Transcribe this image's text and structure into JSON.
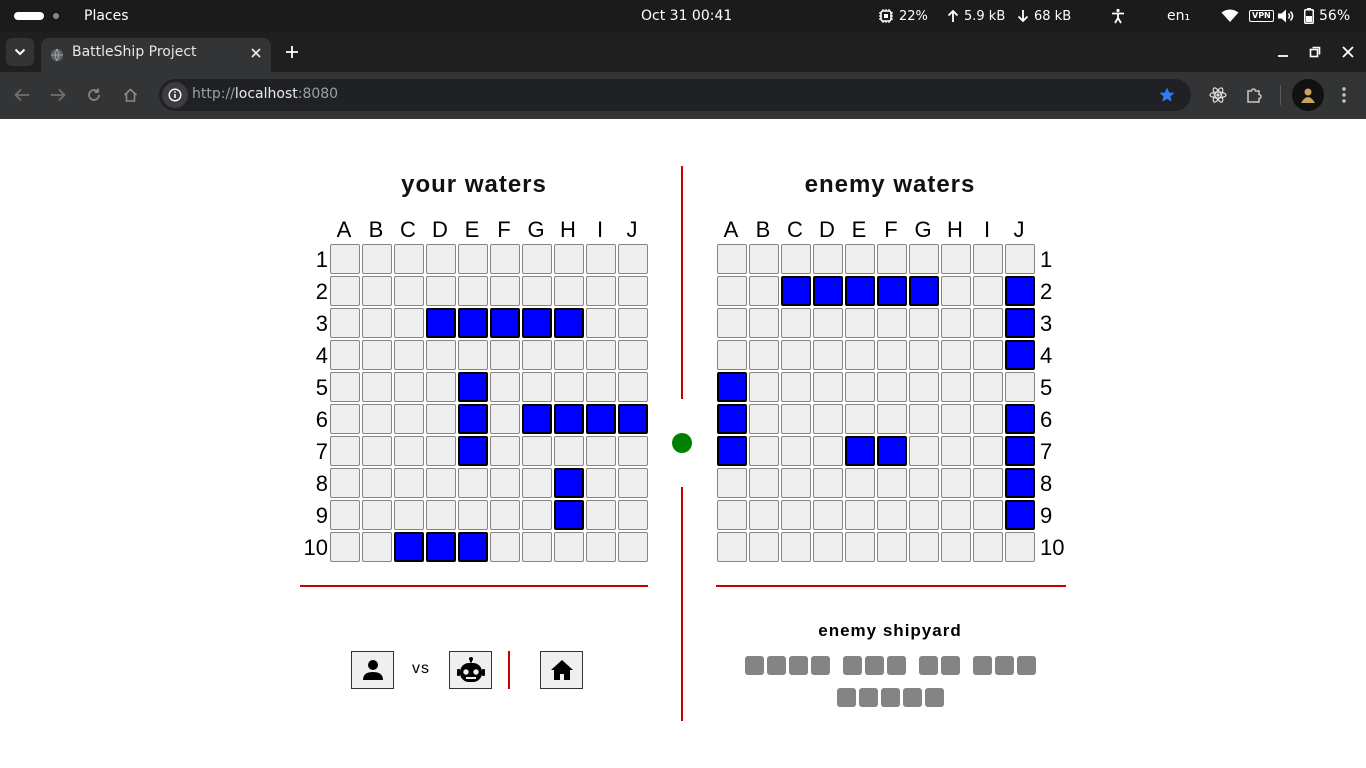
{
  "system_bar": {
    "workspace_label": "Places",
    "datetime": "Oct 31  00:41",
    "cpu": "22%",
    "upload": "5.9 kB",
    "download": "68 kB",
    "lang": "en₁",
    "battery": "56%"
  },
  "browser": {
    "tab_title": "BattleShip Project",
    "url_scheme": "http://",
    "url_host": "localhost",
    "url_port": ":8080"
  },
  "game": {
    "your_title": "your waters",
    "enemy_title": "enemy waters",
    "columns": [
      "A",
      "B",
      "C",
      "D",
      "E",
      "F",
      "G",
      "H",
      "I",
      "J"
    ],
    "rows": [
      "1",
      "2",
      "3",
      "4",
      "5",
      "6",
      "7",
      "8",
      "9",
      "10"
    ],
    "your_ships": [
      "D3",
      "E3",
      "F3",
      "G3",
      "H3",
      "E5",
      "E6",
      "G6",
      "H6",
      "I6",
      "J6",
      "E7",
      "H8",
      "H9",
      "C10",
      "D10",
      "E10"
    ],
    "enemy_ships": [
      "C2",
      "D2",
      "E2",
      "F2",
      "G2",
      "J2",
      "J3",
      "J4",
      "A5",
      "A6",
      "J6",
      "A7",
      "E7",
      "F7",
      "J7",
      "J8",
      "J9"
    ],
    "vs_label": "vs",
    "shipyard_title": "enemy shipyard",
    "shipyard_ships": [
      4,
      3,
      2,
      3,
      5
    ],
    "turn_indicator_color": "#008000"
  },
  "colors": {
    "ship": "#0000ff",
    "water": "#efefef",
    "divider": "#c80000",
    "shipyard": "#848484"
  }
}
